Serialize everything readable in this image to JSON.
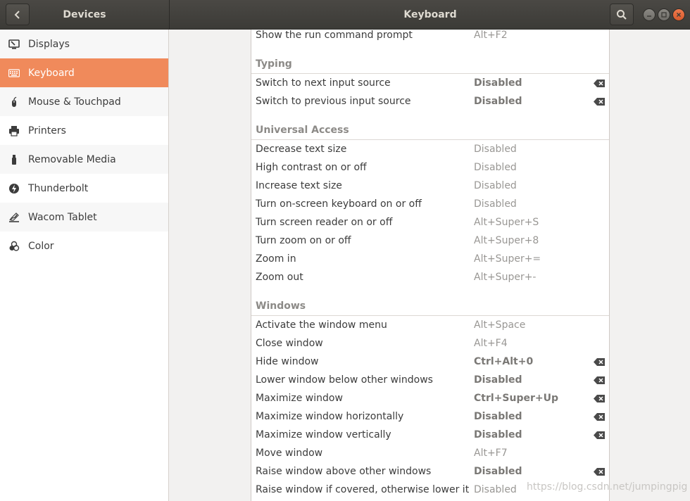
{
  "header": {
    "left_title": "Devices",
    "main_title": "Keyboard"
  },
  "sidebar": {
    "items": [
      {
        "label": "Displays",
        "icon": "display-icon",
        "active": false
      },
      {
        "label": "Keyboard",
        "icon": "keyboard-icon",
        "active": true
      },
      {
        "label": "Mouse & Touchpad",
        "icon": "mouse-icon",
        "active": false
      },
      {
        "label": "Printers",
        "icon": "printer-icon",
        "active": false
      },
      {
        "label": "Removable Media",
        "icon": "usb-drive-icon",
        "active": false
      },
      {
        "label": "Thunderbolt",
        "icon": "thunderbolt-icon",
        "active": false
      },
      {
        "label": "Wacom Tablet",
        "icon": "tablet-icon",
        "active": false
      },
      {
        "label": "Color",
        "icon": "color-icon",
        "active": false
      }
    ]
  },
  "shortcuts": {
    "top_row": {
      "name": "Show the run command prompt",
      "accel": "Alt+F2",
      "custom": false
    },
    "typing": {
      "title": "Typing",
      "rows": [
        {
          "name": "Switch to next input source",
          "accel": "Disabled",
          "custom": true
        },
        {
          "name": "Switch to previous input source",
          "accel": "Disabled",
          "custom": true
        }
      ]
    },
    "universal_access": {
      "title": "Universal Access",
      "rows": [
        {
          "name": "Decrease text size",
          "accel": "Disabled",
          "custom": false
        },
        {
          "name": "High contrast on or off",
          "accel": "Disabled",
          "custom": false
        },
        {
          "name": "Increase text size",
          "accel": "Disabled",
          "custom": false
        },
        {
          "name": "Turn on-screen keyboard on or off",
          "accel": "Disabled",
          "custom": false
        },
        {
          "name": "Turn screen reader on or off",
          "accel": "Alt+Super+S",
          "custom": false
        },
        {
          "name": "Turn zoom on or off",
          "accel": "Alt+Super+8",
          "custom": false
        },
        {
          "name": "Zoom in",
          "accel": "Alt+Super+=",
          "custom": false
        },
        {
          "name": "Zoom out",
          "accel": "Alt+Super+-",
          "custom": false
        }
      ]
    },
    "windows": {
      "title": "Windows",
      "rows": [
        {
          "name": "Activate the window menu",
          "accel": "Alt+Space",
          "custom": false
        },
        {
          "name": "Close window",
          "accel": "Alt+F4",
          "custom": false
        },
        {
          "name": "Hide window",
          "accel": "Ctrl+Alt+0",
          "custom": true
        },
        {
          "name": "Lower window below other windows",
          "accel": "Disabled",
          "custom": true
        },
        {
          "name": "Maximize window",
          "accel": "Ctrl+Super+Up",
          "custom": true
        },
        {
          "name": "Maximize window horizontally",
          "accel": "Disabled",
          "custom": true
        },
        {
          "name": "Maximize window vertically",
          "accel": "Disabled",
          "custom": true
        },
        {
          "name": "Move window",
          "accel": "Alt+F7",
          "custom": false
        },
        {
          "name": "Raise window above other windows",
          "accel": "Disabled",
          "custom": true
        },
        {
          "name": "Raise window if covered, otherwise lower it",
          "accel": "Disabled",
          "custom": false
        }
      ]
    }
  },
  "watermark": "https://blog.csdn.net/jumpingpig",
  "colors": {
    "accent": "#f08a5b",
    "headerbar": "#3c3b37",
    "window_close": "#e9633a"
  }
}
